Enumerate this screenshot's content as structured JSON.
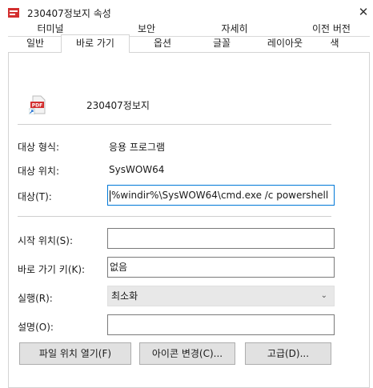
{
  "window": {
    "title": "230407정보지 속성",
    "close_glyph": "✕"
  },
  "tabs_row1": [
    "터미널",
    "보안",
    "자세히",
    "이전 버전"
  ],
  "tabs_row2": [
    "일반",
    "바로 가기",
    "옵션",
    "글꼴",
    "레이아웃",
    "색"
  ],
  "active_tab": "바로 가기",
  "shortcut": {
    "name": "230407정보지",
    "icon_text": "PDF",
    "icon": "pdf-shortcut-icon"
  },
  "properties": {
    "target_type_label": "대상 형식:",
    "target_type_value": "응용 프로그램",
    "target_location_label": "대상 위치:",
    "target_location_value": "SysWOW64",
    "target_label": "대상(T):",
    "target_value": "%windir%\\SysWOW64\\cmd.exe   /c powershell",
    "start_in_label": "시작 위치(S):",
    "start_in_value": "",
    "shortcut_key_label": "바로 가기 키(K):",
    "shortcut_key_value": "없음",
    "run_label": "실행(R):",
    "run_value": "최소화",
    "comment_label": "설명(O):",
    "comment_value": ""
  },
  "buttons": {
    "open_location": "파일 위치 열기(F)",
    "change_icon": "아이콘 변경(C)...",
    "advanced": "고급(D)..."
  },
  "colors": {
    "pdf_red": "#d32f2f",
    "focus_blue": "#0078d7"
  }
}
